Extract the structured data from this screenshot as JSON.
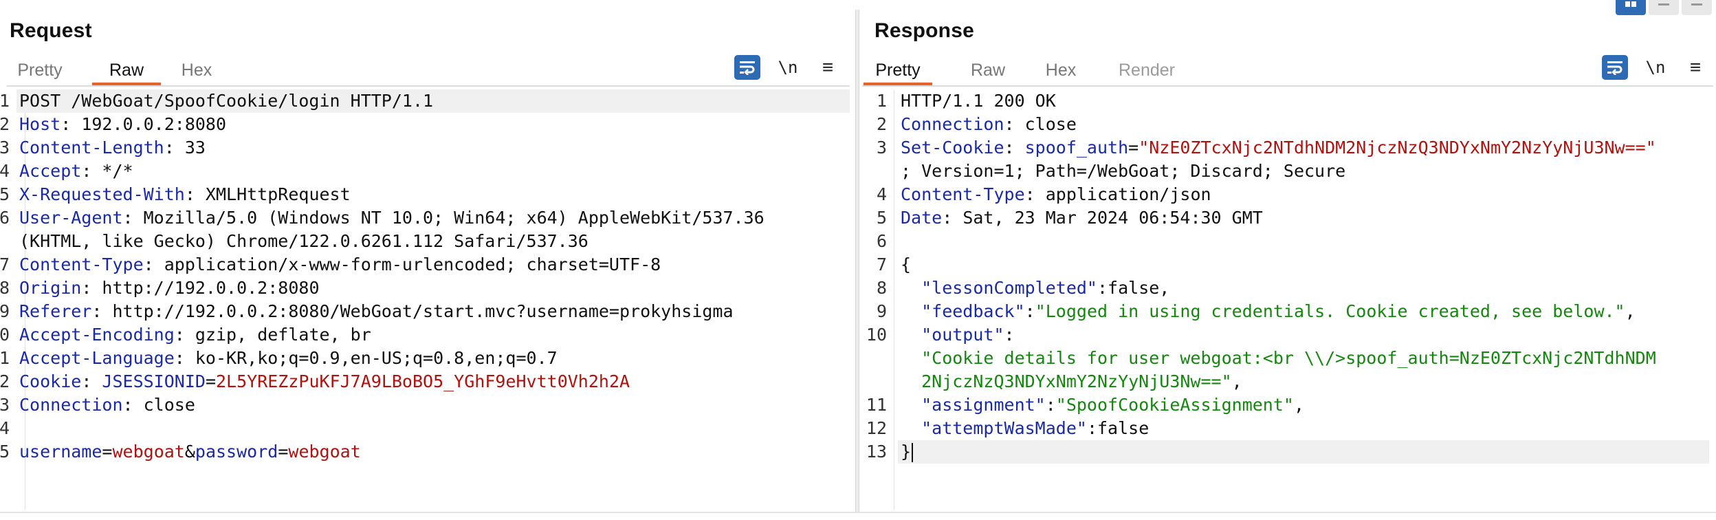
{
  "request": {
    "title": "Request",
    "tabs": [
      {
        "label": "Pretty",
        "state": "inactive"
      },
      {
        "label": "Raw",
        "state": "active"
      },
      {
        "label": "Hex",
        "state": "inactive"
      }
    ],
    "toolbar": {
      "newline_label": "\\n",
      "menu_label": "≡"
    },
    "lines": [
      {
        "num": "1",
        "highlight": true,
        "segments": [
          {
            "t": "POST /WebGoat/SpoofCookie/login HTTP/1.1",
            "c": ""
          }
        ]
      },
      {
        "num": "2",
        "segments": [
          {
            "t": "Host",
            "c": "k"
          },
          {
            "t": ": 192.0.0.2:8080",
            "c": ""
          }
        ]
      },
      {
        "num": "3",
        "segments": [
          {
            "t": "Content-Length",
            "c": "k"
          },
          {
            "t": ": 33",
            "c": ""
          }
        ]
      },
      {
        "num": "4",
        "segments": [
          {
            "t": "Accept",
            "c": "k"
          },
          {
            "t": ": */*",
            "c": ""
          }
        ]
      },
      {
        "num": "5",
        "segments": [
          {
            "t": "X-Requested-With",
            "c": "k"
          },
          {
            "t": ": XMLHttpRequest",
            "c": ""
          }
        ]
      },
      {
        "num": "6",
        "segments": [
          {
            "t": "User-Agent",
            "c": "k"
          },
          {
            "t": ": Mozilla/5.0 (Windows NT 10.0; Win64; x64) AppleWebKit/537.36",
            "c": ""
          }
        ]
      },
      {
        "num": "",
        "segments": [
          {
            "t": "(KHTML, like Gecko) Chrome/122.0.6261.112 Safari/537.36",
            "c": ""
          }
        ]
      },
      {
        "num": "7",
        "segments": [
          {
            "t": "Content-Type",
            "c": "k"
          },
          {
            "t": ": application/x-www-form-urlencoded; charset=UTF-8",
            "c": ""
          }
        ]
      },
      {
        "num": "8",
        "segments": [
          {
            "t": "Origin",
            "c": "k"
          },
          {
            "t": ": http://192.0.0.2:8080",
            "c": ""
          }
        ]
      },
      {
        "num": "9",
        "segments": [
          {
            "t": "Referer",
            "c": "k"
          },
          {
            "t": ": http://192.0.0.2:8080/WebGoat/start.mvc?username=prokyhsigma",
            "c": ""
          }
        ]
      },
      {
        "num": "0",
        "segments": [
          {
            "t": "Accept-Encoding",
            "c": "k"
          },
          {
            "t": ": gzip, deflate, br",
            "c": ""
          }
        ]
      },
      {
        "num": "1",
        "segments": [
          {
            "t": "Accept-Language",
            "c": "k"
          },
          {
            "t": ": ko-KR,ko;q=0.9,en-US;q=0.8,en;q=0.7",
            "c": ""
          }
        ]
      },
      {
        "num": "2",
        "segments": [
          {
            "t": "Cookie",
            "c": "k"
          },
          {
            "t": ": ",
            "c": ""
          },
          {
            "t": "JSESSIONID",
            "c": "k"
          },
          {
            "t": "=",
            "c": ""
          },
          {
            "t": "2L5YREZzPuKFJ7A9LBoBO5_YGhF9eHvtt0Vh2h2A",
            "c": "v"
          }
        ]
      },
      {
        "num": "3",
        "segments": [
          {
            "t": "Connection",
            "c": "k"
          },
          {
            "t": ": close",
            "c": ""
          }
        ]
      },
      {
        "num": "4",
        "segments": []
      },
      {
        "num": "5",
        "segments": [
          {
            "t": "username",
            "c": "k"
          },
          {
            "t": "=",
            "c": ""
          },
          {
            "t": "webgoat",
            "c": "v"
          },
          {
            "t": "&",
            "c": ""
          },
          {
            "t": "password",
            "c": "k"
          },
          {
            "t": "=",
            "c": ""
          },
          {
            "t": "webgoat",
            "c": "v"
          }
        ]
      }
    ]
  },
  "response": {
    "title": "Response",
    "tabs": [
      {
        "label": "Pretty",
        "state": "active"
      },
      {
        "label": "Raw",
        "state": "inactive"
      },
      {
        "label": "Hex",
        "state": "inactive"
      },
      {
        "label": "Render",
        "state": "disabled"
      }
    ],
    "toolbar": {
      "newline_label": "\\n",
      "menu_label": "≡"
    },
    "lines": [
      {
        "num": "1",
        "segments": [
          {
            "t": "HTTP/1.1 200 OK",
            "c": ""
          }
        ]
      },
      {
        "num": "2",
        "segments": [
          {
            "t": "Connection",
            "c": "k"
          },
          {
            "t": ": close",
            "c": ""
          }
        ]
      },
      {
        "num": "3",
        "segments": [
          {
            "t": "Set-Cookie",
            "c": "k"
          },
          {
            "t": ": ",
            "c": ""
          },
          {
            "t": "spoof_auth",
            "c": "k"
          },
          {
            "t": "=",
            "c": ""
          },
          {
            "t": "\"NzE0ZTcxNjc2NTdhNDM2NjczNzQ3NDYxNmY2NzYyNjU3Nw==\"",
            "c": "v"
          }
        ]
      },
      {
        "num": "",
        "segments": [
          {
            "t": "; Version=1; Path=/WebGoat; Discard; Secure",
            "c": ""
          }
        ]
      },
      {
        "num": "4",
        "segments": [
          {
            "t": "Content-Type",
            "c": "k"
          },
          {
            "t": ": application/json",
            "c": ""
          }
        ]
      },
      {
        "num": "5",
        "segments": [
          {
            "t": "Date",
            "c": "k"
          },
          {
            "t": ": Sat, 23 Mar 2024 06:54:30 GMT",
            "c": ""
          }
        ]
      },
      {
        "num": "6",
        "segments": []
      },
      {
        "num": "7",
        "segments": [
          {
            "t": "{",
            "c": ""
          }
        ]
      },
      {
        "num": "8",
        "segments": [
          {
            "t": "  \"lessonCompleted\"",
            "c": "k"
          },
          {
            "t": ":false,",
            "c": ""
          }
        ]
      },
      {
        "num": "9",
        "segments": [
          {
            "t": "  \"feedback\"",
            "c": "k"
          },
          {
            "t": ":",
            "c": ""
          },
          {
            "t": "\"Logged in using credentials. Cookie created, see below.\"",
            "c": "s"
          },
          {
            "t": ",",
            "c": ""
          }
        ]
      },
      {
        "num": "10",
        "segments": [
          {
            "t": "  \"output\"",
            "c": "k"
          },
          {
            "t": ":",
            "c": ""
          }
        ]
      },
      {
        "num": "",
        "segments": [
          {
            "t": "  \"Cookie details for user webgoat:<br \\\\/>spoof_auth=NzE0ZTcxNjc2NTdhNDM",
            "c": "s"
          }
        ]
      },
      {
        "num": "",
        "segments": [
          {
            "t": "  2NjczNzQ3NDYxNmY2NzYyNjU3Nw==\"",
            "c": "s"
          },
          {
            "t": ",",
            "c": ""
          }
        ]
      },
      {
        "num": "11",
        "segments": [
          {
            "t": "  \"assignment\"",
            "c": "k"
          },
          {
            "t": ":",
            "c": ""
          },
          {
            "t": "\"SpoofCookieAssignment\"",
            "c": "s"
          },
          {
            "t": ",",
            "c": ""
          }
        ]
      },
      {
        "num": "12",
        "segments": [
          {
            "t": "  \"attemptWasMade\"",
            "c": "k"
          },
          {
            "t": ":false",
            "c": ""
          }
        ]
      },
      {
        "num": "13",
        "highlight": true,
        "cursor": true,
        "segments": [
          {
            "t": "}",
            "c": ""
          }
        ]
      }
    ]
  },
  "colors": {
    "accent_tab": "#e8622c",
    "key": "#1a2aa6",
    "value": "#b0120e",
    "json_string": "#15870f",
    "button_blue": "#2d6bb5"
  }
}
